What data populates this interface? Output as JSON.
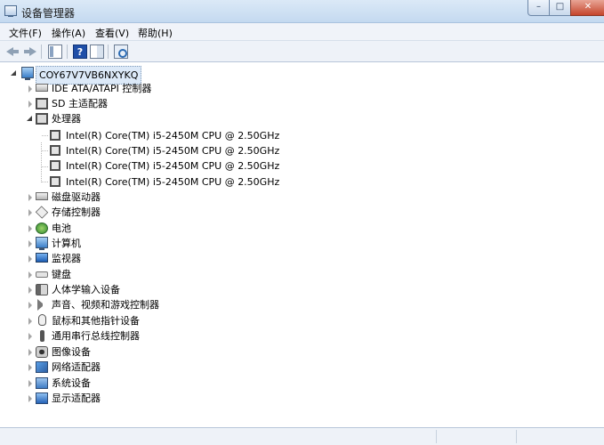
{
  "window": {
    "title": "设备管理器",
    "controls": {
      "minimize": "–",
      "maximize": "□",
      "close": "✕"
    }
  },
  "menubar": {
    "items": [
      "文件(F)",
      "操作(A)",
      "查看(V)",
      "帮助(H)"
    ]
  },
  "toolbar": {
    "buttons": [
      "back-icon",
      "forward-icon",
      "properties-pane-icon",
      "help-icon",
      "view-grid-icon",
      "scan-hardware-icon"
    ]
  },
  "tree": {
    "root": "COY67V7VB6NXYKQ",
    "categories": [
      {
        "label": "IDE ATA/ATAPI 控制器",
        "icon": "ide-controller-icon",
        "expanded": false
      },
      {
        "label": "SD 主适配器",
        "icon": "sd-host-icon",
        "expanded": false
      },
      {
        "label": "处理器",
        "icon": "processor-icon",
        "expanded": true,
        "children": [
          "Intel(R) Core(TM) i5-2450M CPU @ 2.50GHz",
          "Intel(R) Core(TM) i5-2450M CPU @ 2.50GHz",
          "Intel(R) Core(TM) i5-2450M CPU @ 2.50GHz",
          "Intel(R) Core(TM) i5-2450M CPU @ 2.50GHz"
        ]
      },
      {
        "label": "磁盘驱动器",
        "icon": "disk-drive-icon",
        "expanded": false
      },
      {
        "label": "存储控制器",
        "icon": "storage-controller-icon",
        "expanded": false
      },
      {
        "label": "电池",
        "icon": "battery-icon",
        "expanded": false
      },
      {
        "label": "计算机",
        "icon": "computer-icon",
        "expanded": false
      },
      {
        "label": "监视器",
        "icon": "monitor-icon",
        "expanded": false
      },
      {
        "label": "键盘",
        "icon": "keyboard-icon",
        "expanded": false
      },
      {
        "label": "人体学输入设备",
        "icon": "hid-icon",
        "expanded": false
      },
      {
        "label": "声音、视频和游戏控制器",
        "icon": "sound-icon",
        "expanded": false
      },
      {
        "label": "鼠标和其他指针设备",
        "icon": "mouse-icon",
        "expanded": false
      },
      {
        "label": "通用串行总线控制器",
        "icon": "usb-icon",
        "expanded": false
      },
      {
        "label": "图像设备",
        "icon": "camera-icon",
        "expanded": false
      },
      {
        "label": "网络适配器",
        "icon": "network-adapter-icon",
        "expanded": false
      },
      {
        "label": "系统设备",
        "icon": "system-device-icon",
        "expanded": false
      },
      {
        "label": "显示适配器",
        "icon": "display-adapter-icon",
        "expanded": false
      }
    ]
  },
  "colors": {
    "title_bar": "#c4d9f0",
    "selection": "#dce9f8",
    "close_button": "#c5452c"
  }
}
